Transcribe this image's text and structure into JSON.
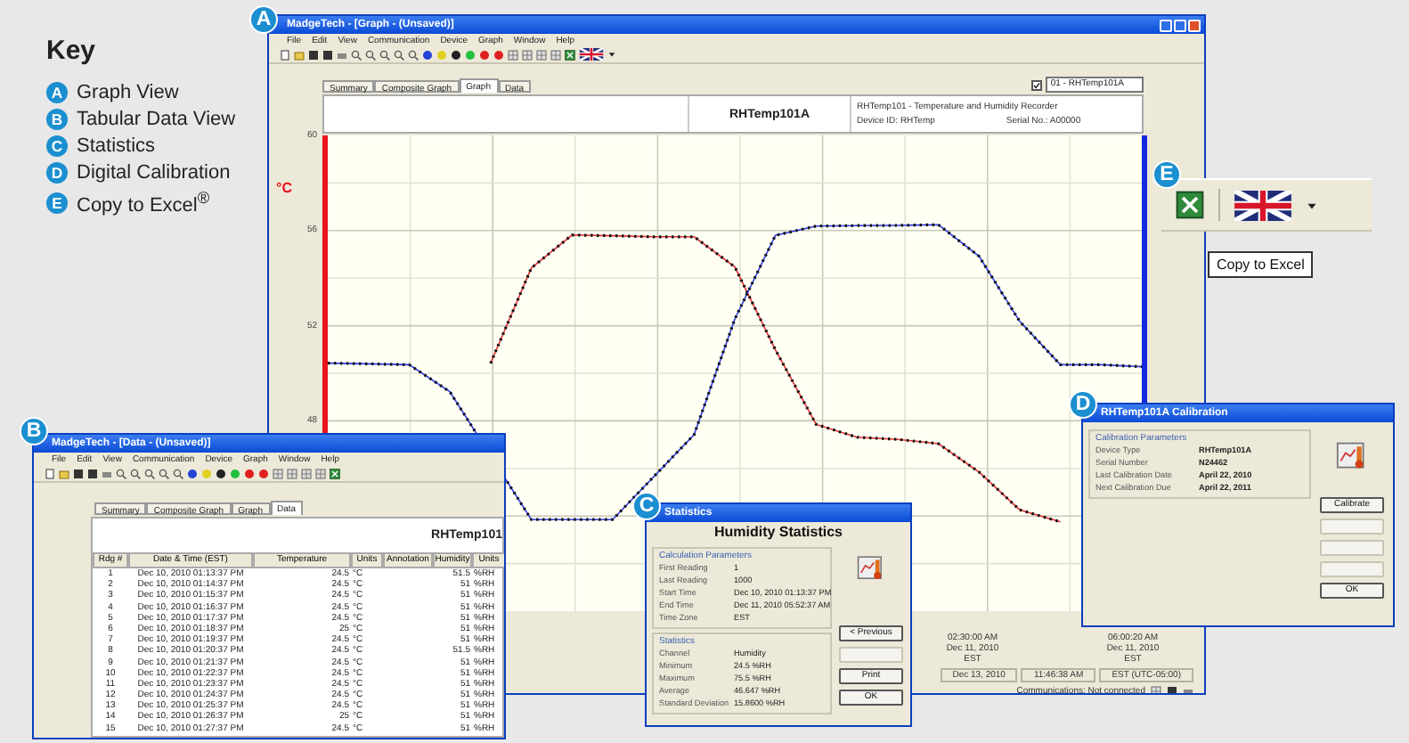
{
  "key": {
    "title": "Key",
    "items": [
      {
        "letter": "A",
        "label": "Graph View"
      },
      {
        "letter": "B",
        "label": "Tabular Data View"
      },
      {
        "letter": "C",
        "label": "Statistics"
      },
      {
        "letter": "D",
        "label": "Digital Calibration"
      },
      {
        "letter": "E",
        "label": "Copy to Excel$^{®}$"
      }
    ]
  },
  "graph_window": {
    "badge": "A",
    "title": "MadgeTech - [Graph - (Unsaved)]",
    "menu": [
      "File",
      "Edit",
      "View",
      "Communication",
      "Device",
      "Graph",
      "Window",
      "Help"
    ],
    "tabs": [
      {
        "label": "Summary",
        "selected": false
      },
      {
        "label": "Composite Graph",
        "selected": false
      },
      {
        "label": "Graph",
        "selected": true
      },
      {
        "label": "Data",
        "selected": false
      }
    ],
    "channel_checkbox": {
      "checked": true
    },
    "channel_select": "01 - RHTemp101A",
    "header": {
      "device": "RHTemp101A",
      "description": "RHTemp101 - Temperature and Humidity Recorder",
      "device_id": "Device ID: RHTemp",
      "serial": "Serial No.: A00000"
    },
    "chart_data": {
      "type": "line",
      "ylabel": "°C",
      "grid": true,
      "ylim": [
        40,
        60
      ],
      "yticks": [
        48,
        52,
        56,
        60
      ],
      "series": [
        {
          "color": "#e03030",
          "values": [
            null,
            null,
            null,
            null,
            50.42,
            54.43,
            55.81,
            55.78,
            55.74,
            55.74,
            54.47,
            50.99,
            47.85,
            47.31,
            47.22,
            47.04,
            45.85,
            44.26,
            43.75,
            null,
            null
          ]
        },
        {
          "color": "#2f3ae0",
          "values": [
            50.43,
            50.4,
            50.36,
            49.23,
            null,
            43.85,
            43.85,
            43.85,
            null,
            47.42,
            52.28,
            55.8,
            56.19,
            56.21,
            56.22,
            56.25,
            54.92,
            52.19,
            50.36,
            50.36,
            50.28
          ]
        }
      ]
    },
    "time_labels": [
      {
        "time": "02:30:00 AM",
        "date": "Dec 11, 2010",
        "zone": "EST"
      },
      {
        "time": "06:00:20 AM",
        "date": "Dec 11, 2010",
        "zone": "EST"
      }
    ],
    "status_bar": {
      "date": "Dec 13, 2010",
      "time": "11:46:38 AM",
      "zone": "EST (UTC-05:00)",
      "communications": "Communications: Not connected"
    }
  },
  "data_window": {
    "badge": "B",
    "title": "MadgeTech - [Data - (Unsaved)]",
    "menu": [
      "File",
      "Edit",
      "View",
      "Communication",
      "Device",
      "Graph",
      "Window",
      "Help"
    ],
    "tabs": [
      {
        "label": "Summary",
        "selected": false
      },
      {
        "label": "Composite Graph",
        "selected": false
      },
      {
        "label": "Graph",
        "selected": false
      },
      {
        "label": "Data",
        "selected": true
      }
    ],
    "heading": "RHTemp101",
    "table": {
      "columns": [
        "Rdg #",
        "Date & Time (EST)",
        "Temperature",
        "Units",
        "Annotation",
        "Humidity",
        "Units"
      ],
      "rows": [
        [
          "1",
          "Dec 10, 2010 01:13:37 PM",
          "24.5",
          "°C",
          "",
          "51.5",
          "%RH"
        ],
        [
          "2",
          "Dec 10, 2010 01:14:37 PM",
          "24.5",
          "°C",
          "",
          "51",
          "%RH"
        ],
        [
          "3",
          "Dec 10, 2010 01:15:37 PM",
          "24.5",
          "°C",
          "",
          "51",
          "%RH"
        ],
        [
          "4",
          "Dec 10, 2010 01:16:37 PM",
          "24.5",
          "°C",
          "",
          "51",
          "%RH"
        ],
        [
          "5",
          "Dec 10, 2010 01:17:37 PM",
          "24.5",
          "°C",
          "",
          "51",
          "%RH"
        ],
        [
          "6",
          "Dec 10, 2010 01:18:37 PM",
          "25",
          "°C",
          "",
          "51",
          "%RH"
        ],
        [
          "7",
          "Dec 10, 2010 01:19:37 PM",
          "24.5",
          "°C",
          "",
          "51",
          "%RH"
        ],
        [
          "8",
          "Dec 10, 2010 01:20:37 PM",
          "24.5",
          "°C",
          "",
          "51.5",
          "%RH"
        ],
        [
          "9",
          "Dec 10, 2010 01:21:37 PM",
          "24.5",
          "°C",
          "",
          "51",
          "%RH"
        ],
        [
          "10",
          "Dec 10, 2010 01:22:37 PM",
          "24.5",
          "°C",
          "",
          "51",
          "%RH"
        ],
        [
          "11",
          "Dec 10, 2010 01:23:37 PM",
          "24.5",
          "°C",
          "",
          "51",
          "%RH"
        ],
        [
          "12",
          "Dec 10, 2010 01:24:37 PM",
          "24.5",
          "°C",
          "",
          "51",
          "%RH"
        ],
        [
          "13",
          "Dec 10, 2010 01:25:37 PM",
          "24.5",
          "°C",
          "",
          "51",
          "%RH"
        ],
        [
          "14",
          "Dec 10, 2010 01:26:37 PM",
          "25",
          "°C",
          "",
          "51",
          "%RH"
        ],
        [
          "15",
          "Dec 10, 2010 01:27:37 PM",
          "24.5",
          "°C",
          "",
          "51",
          "%RH"
        ]
      ]
    }
  },
  "statistics_window": {
    "badge": "C",
    "title": "Statistics",
    "heading": "Humidity Statistics",
    "groups": [
      {
        "title": "Calculation Parameters",
        "rows": [
          {
            "label": "First Reading",
            "value": "1"
          },
          {
            "label": "Last Reading",
            "value": "1000"
          },
          {
            "label": "Start Time",
            "value": "Dec 10, 2010 01:13:37 PM"
          },
          {
            "label": "End Time",
            "value": "Dec 11, 2010 05:52:37 AM"
          },
          {
            "label": "Time Zone",
            "value": "EST"
          }
        ]
      },
      {
        "title": "Statistics",
        "rows": [
          {
            "label": "Channel",
            "value": "Humidity"
          },
          {
            "label": "Minimum",
            "value": "24.5 %RH"
          },
          {
            "label": "Maximum",
            "value": "75.5 %RH"
          },
          {
            "label": "Average",
            "value": "46.647 %RH"
          },
          {
            "label": "Standard Deviation",
            "value": "15.8600 %RH"
          }
        ]
      }
    ],
    "buttons": [
      {
        "label": "< Previous",
        "disabled": false
      },
      {
        "disabled": true
      },
      {
        "label": "Print",
        "disabled": false
      },
      {
        "label": "OK",
        "disabled": false
      }
    ]
  },
  "calibration_window": {
    "badge": "D",
    "title": "RHTemp101A Calibration",
    "group": "Calibration Parameters",
    "rows": [
      {
        "label": "Device Type",
        "value": "RHTemp101A"
      },
      {
        "label": "Serial Number",
        "value": "N24462"
      },
      {
        "label": "Last Calibration Date",
        "value": "April 22, 2010"
      },
      {
        "label": "Next Calibration Due",
        "value": "April 22, 2011"
      }
    ],
    "buttons": [
      {
        "label": "Calibrate",
        "disabled": false
      },
      {
        "disabled": true
      },
      {
        "disabled": true
      },
      {
        "disabled": true
      },
      {
        "label": "OK",
        "disabled": false
      }
    ]
  },
  "excel_callout": {
    "badge": "E",
    "tooltip": "Copy to Excel"
  }
}
